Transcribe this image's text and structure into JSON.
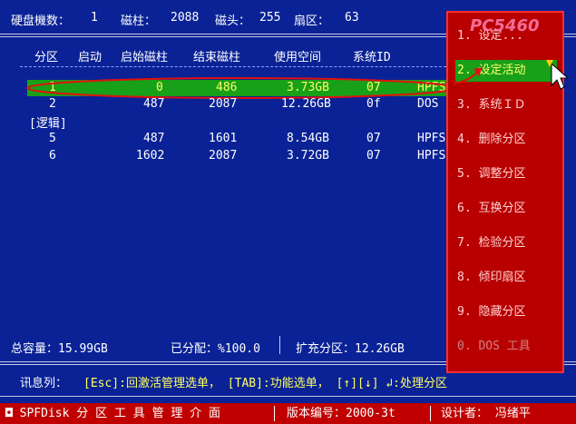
{
  "topbar": {
    "disk_count_label": "硬盘機数：",
    "disk_count": "1",
    "cylinders_label": "磁柱：",
    "cylinders": "2088",
    "heads_label": "磁头：",
    "heads": "255",
    "sectors_label": "扇区：",
    "sectors": "63"
  },
  "table": {
    "headers": [
      "分区",
      "启动",
      "启始磁柱",
      "结束磁柱",
      "使用空间",
      "系统ID"
    ],
    "logical_label": "[逻辑]",
    "rows": [
      {
        "part": "1",
        "boot": "0",
        "start": "486",
        "end": "3.73GB",
        "size": "07",
        "sysid": "HPFS"
      },
      {
        "part": "2",
        "boot": "487",
        "start": "2087",
        "end": "12.26GB",
        "size": "0f",
        "sysid": "DOS"
      },
      {
        "part": "5",
        "boot": "487",
        "start": "1601",
        "end": "8.54GB",
        "size": "07",
        "sysid": "HPFS"
      },
      {
        "part": "6",
        "boot": "1602",
        "start": "2087",
        "end": "3.72GB",
        "size": "07",
        "sysid": "HPFS"
      }
    ]
  },
  "summary": {
    "total": "总容量：15.99GB",
    "allocated": "已分配：%100.0",
    "extended": "扩充分区：12.26GB"
  },
  "info_bar": {
    "label": "讯息列：",
    "text": "[Esc]:回激活管理选单， [TAB]:功能选单， [↑][↓] ↲:处理分区"
  },
  "menu": {
    "items": [
      {
        "label": "1. 设定...",
        "state": "normal"
      },
      {
        "label": "2. 设定活动",
        "state": "active"
      },
      {
        "label": "3. 系统ＩＤ",
        "state": "normal"
      },
      {
        "label": "4. 删除分区",
        "state": "normal"
      },
      {
        "label": "5. 调整分区",
        "state": "normal"
      },
      {
        "label": "6. 互换分区",
        "state": "normal"
      },
      {
        "label": "7. 检验分区",
        "state": "normal"
      },
      {
        "label": "8. 倾印扇区",
        "state": "normal"
      },
      {
        "label": "9. 隐藏分区",
        "state": "normal"
      },
      {
        "label": "0. DOS 工具",
        "state": "disabled"
      }
    ]
  },
  "watermark": "PC5460",
  "statusbar": {
    "app": "◘ SPFDisk 分 区 工 具 管 理 介 面",
    "version": "版本编号：2000-3t",
    "designer": "设计者： 冯绪平"
  },
  "colors": {
    "background": "#0a2296",
    "selected_row": "#18a018",
    "menu_bg": "#b80000",
    "status_bg": "#c00000",
    "highlight_text": "#ffff60"
  }
}
